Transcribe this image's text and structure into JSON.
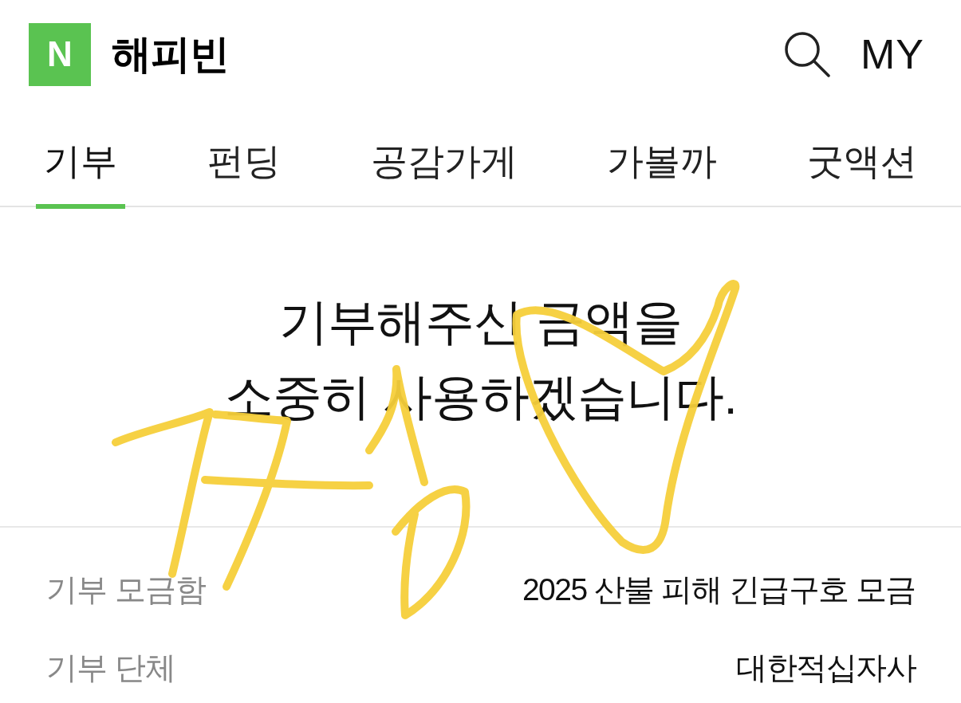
{
  "header": {
    "logo": "N",
    "title": "해피빈",
    "my_label": "MY"
  },
  "tabs": [
    {
      "label": "기부",
      "selected": true
    },
    {
      "label": "펀딩",
      "selected": false
    },
    {
      "label": "공감가게",
      "selected": false
    },
    {
      "label": "가볼까",
      "selected": false
    },
    {
      "label": "굿액션",
      "selected": false
    }
  ],
  "message": "기부해주신 금액을\n소중히 사용하겠습니다.",
  "details": [
    {
      "label": "기부 모금함",
      "value": "2025 산불 피해 긴급구호 모금"
    },
    {
      "label": "기부 단체",
      "value": "대한적십자사"
    }
  ]
}
